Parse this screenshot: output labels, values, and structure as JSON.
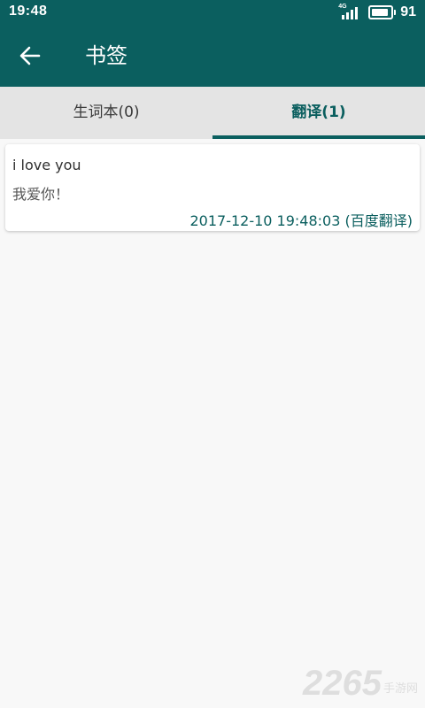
{
  "status_bar": {
    "time": "19:48",
    "network": "4G",
    "battery_level": "91",
    "signal_icon": "cellular-signal-icon",
    "battery_icon": "battery-icon"
  },
  "header": {
    "title": "书签",
    "back_icon": "arrow-left-icon"
  },
  "tabs": [
    {
      "label": "生词本(0)",
      "active": false
    },
    {
      "label": "翻译(1)",
      "active": true
    }
  ],
  "entries": [
    {
      "source": "i love you",
      "translation": "我爱你！",
      "meta": "2017-12-10 19:48:03 (百度翻译)"
    }
  ],
  "watermark": {
    "number": "2265",
    "text": "手游网"
  },
  "colors": {
    "primary": "#0b5f5f",
    "tab_bar": "#e4e4e4",
    "background": "#f8f8f8"
  }
}
